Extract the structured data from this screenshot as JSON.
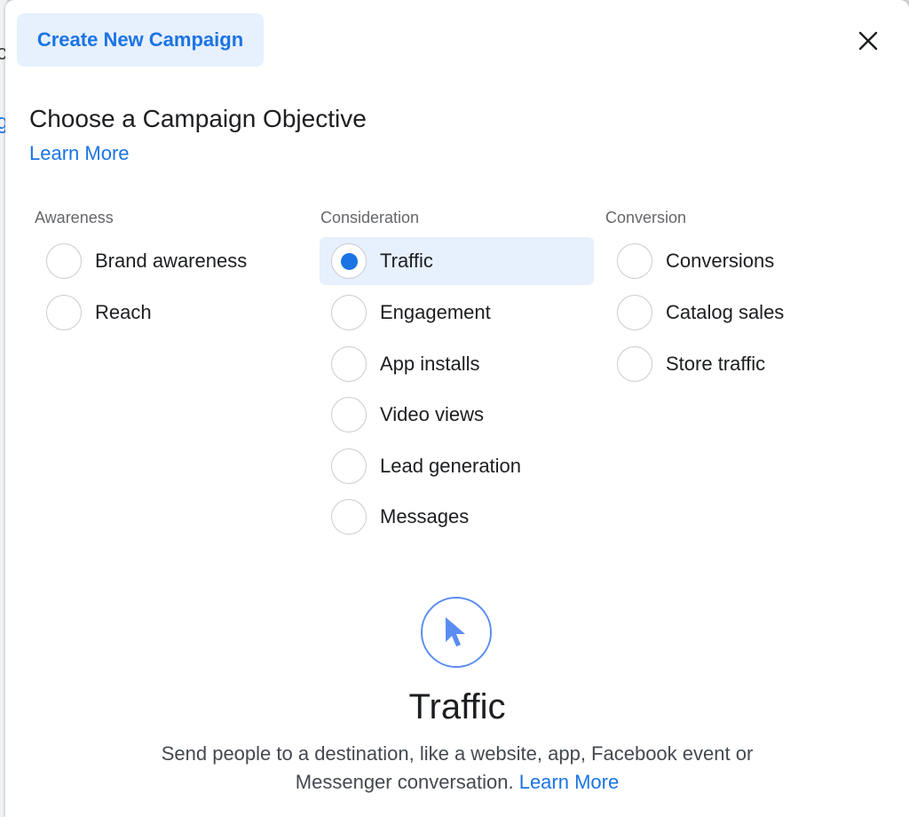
{
  "background": {
    "fragments": [
      "c",
      "g"
    ]
  },
  "dialog": {
    "tab_label": "Create New Campaign",
    "close_icon": "close-icon",
    "heading": "Choose a Campaign Objective",
    "learn_more": "Learn More"
  },
  "columns": [
    {
      "title": "Awareness",
      "options": [
        {
          "label": "Brand awareness",
          "selected": false
        },
        {
          "label": "Reach",
          "selected": false
        }
      ]
    },
    {
      "title": "Consideration",
      "options": [
        {
          "label": "Traffic",
          "selected": true
        },
        {
          "label": "Engagement",
          "selected": false
        },
        {
          "label": "App installs",
          "selected": false
        },
        {
          "label": "Video views",
          "selected": false
        },
        {
          "label": "Lead generation",
          "selected": false
        },
        {
          "label": "Messages",
          "selected": false
        }
      ]
    },
    {
      "title": "Conversion",
      "options": [
        {
          "label": "Conversions",
          "selected": false
        },
        {
          "label": "Catalog sales",
          "selected": false
        },
        {
          "label": "Store traffic",
          "selected": false
        }
      ]
    }
  ],
  "description": {
    "icon": "cursor-arrow-icon",
    "title": "Traffic",
    "text_line1": "Send people to a destination, like a website, app, Facebook event or",
    "text_line2": "Messenger conversation.",
    "link": "Learn More"
  },
  "colors": {
    "accent": "#1b74e4",
    "selected_bg": "#e7f0fd",
    "icon_ring": "#5b8df0"
  }
}
